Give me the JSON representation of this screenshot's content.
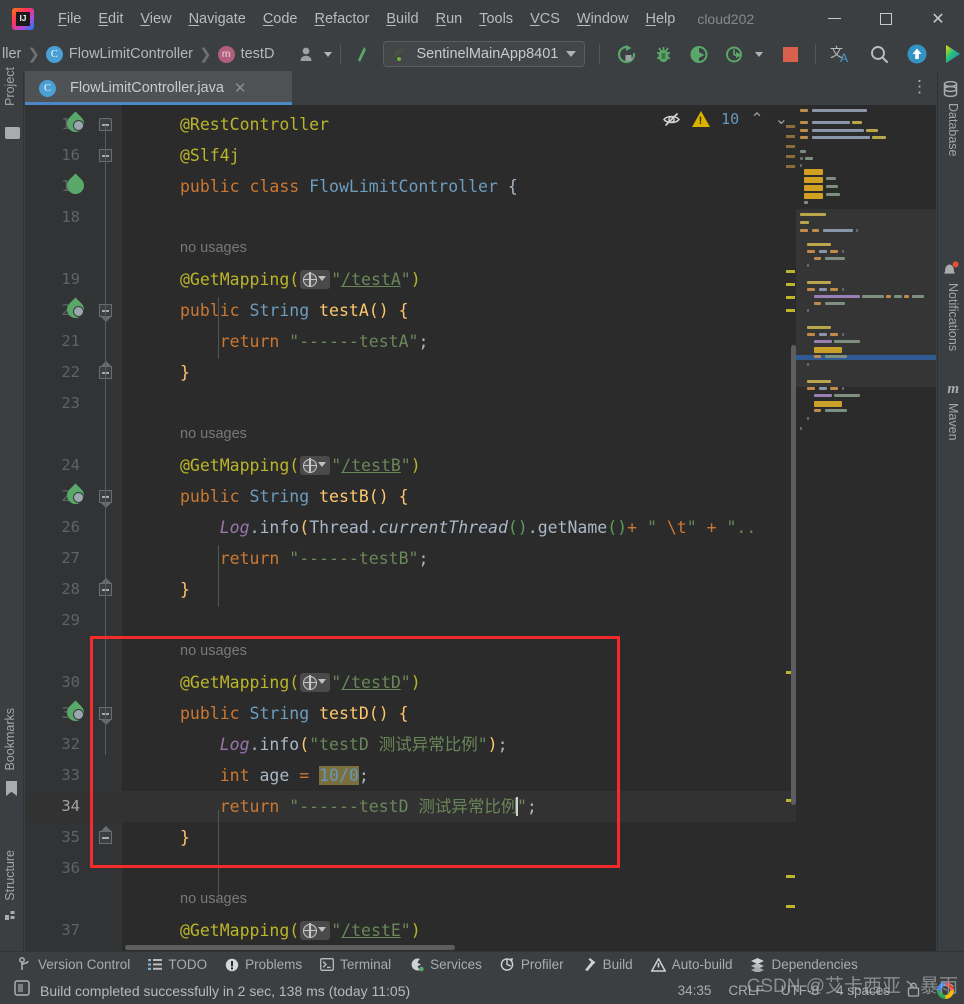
{
  "titlebar": {
    "logo_icon": "intellij-logo-icon",
    "menus": [
      "File",
      "Edit",
      "View",
      "Navigate",
      "Code",
      "Refactor",
      "Build",
      "Run",
      "Tools",
      "VCS",
      "Window",
      "Help"
    ],
    "project_title": "cloud202",
    "minimize": "–",
    "maximize": "▢",
    "close": "✕"
  },
  "toolbar": {
    "breadcrumb": [
      {
        "label": "ller",
        "icon": "none"
      },
      {
        "label": "FlowLimitController",
        "icon": "class-icon",
        "glyph": "C"
      },
      {
        "label": "testD",
        "icon": "method-icon",
        "glyph": "m"
      }
    ],
    "user_icon": "user-avatar-icon",
    "updates_icon": "update-arrow-icon",
    "run_config": "SentinelMainApp8401",
    "run_config_icon": "spring-boot-icon",
    "buttons": [
      "rerun-icon",
      "debug-icon",
      "run-with-coverage-icon",
      "profiler-icon",
      "stop-icon",
      "translate-icon",
      "search-everywhere-icon",
      "update-project-icon",
      "ide-feature-icon"
    ]
  },
  "left_stripe": [
    {
      "label": "Project",
      "icon": "project-folder-icon"
    },
    {
      "label": "Bookmarks",
      "icon": "bookmark-icon"
    },
    {
      "label": "Structure",
      "icon": "structure-icon"
    }
  ],
  "right_stripe": [
    {
      "label": "Database",
      "icon": "database-icon"
    },
    {
      "label": "Notifications",
      "icon": "bell-icon"
    },
    {
      "label": "Maven",
      "icon": "maven-icon"
    }
  ],
  "editor_tab": {
    "filename": "FlowLimitController.java",
    "icon": "java-class-icon",
    "close": "✕",
    "kebab": "⋮"
  },
  "inspections": {
    "eye_icon": "eye-off-icon",
    "warning_icon": "warning-triangle-icon",
    "warning_count": "10",
    "prev": "⌃",
    "next": "⌄"
  },
  "code": {
    "lines": [
      {
        "num": "15",
        "marker": "run-leaf-check",
        "fold": "top",
        "text_html": "<span class=\"ann\">@RestController</span>"
      },
      {
        "num": "16",
        "marker": "",
        "fold": "plain",
        "text_html": "<span class=\"ann\">@Slf4j</span>"
      },
      {
        "num": "17",
        "marker": "run-leaf",
        "fold": "",
        "text_html": "<span class=\"k\">public</span> <span class=\"k\">class</span> <span class=\"typ\">FlowLimitController</span> <span class=\"pun\">{</span>"
      },
      {
        "num": "18",
        "marker": "",
        "fold": "",
        "text_html": ""
      },
      {
        "num": "",
        "marker": "",
        "usage": "no usages",
        "fold": "",
        "text_html": ""
      },
      {
        "num": "19",
        "marker": "",
        "fold": "",
        "text_html": "<span class=\"ann\">@GetMapping(</span><WEB><span class=\"str\">\"</span><span class=\"url\">/testA</span><span class=\"str\">\"</span><span class=\"ann\">)</span>"
      },
      {
        "num": "20",
        "marker": "run-leaf-web",
        "fold": "pt",
        "text_html": "<span class=\"k\">public</span> <span class=\"typ\">String</span> <span class=\"mth\">testA</span><span class=\"brk\">()</span> <span class=\"brk\">{</span>"
      },
      {
        "num": "21",
        "marker": "",
        "fold": "",
        "text_html": "    <span class=\"k\">return</span> <span class=\"str\">\"------testA\"</span><span class=\"pun\">;</span>"
      },
      {
        "num": "22",
        "marker": "",
        "fold": "bt",
        "text_html": "<span class=\"brk\">}</span>"
      },
      {
        "num": "23",
        "marker": "",
        "fold": "",
        "text_html": ""
      },
      {
        "num": "",
        "marker": "",
        "usage": "no usages",
        "fold": "",
        "text_html": ""
      },
      {
        "num": "24",
        "marker": "",
        "fold": "",
        "text_html": "<span class=\"ann\">@GetMapping(</span><WEB><span class=\"str\">\"</span><span class=\"url\">/testB</span><span class=\"str\">\"</span><span class=\"ann\">)</span>"
      },
      {
        "num": "25",
        "marker": "run-leaf-web",
        "fold": "pt",
        "text_html": "<span class=\"k\">public</span> <span class=\"typ\">String</span> <span class=\"mth\">testB</span><span class=\"brk\">()</span> <span class=\"brk\">{</span>"
      },
      {
        "num": "26",
        "marker": "",
        "fold": "",
        "text_html": "    <span class=\"fld\">Log</span><span class=\"pun\">.</span>info<span class=\"brk\">(</span><span class=\"cls\">Thread</span><span class=\"pun\">.</span><span class=\"itl\">currentThread</span><span class=\"par-g\">()</span><span class=\"pun\">.</span>getName<span class=\"par-g\">()</span><span class=\"k\">+</span> <span class=\"str\">\" </span><span class=\"esc\">\\t</span><span class=\"str\">\"</span> <span class=\"k\">+</span> <span class=\"str\">\"..</span>"
      },
      {
        "num": "27",
        "marker": "",
        "fold": "",
        "text_html": "    <span class=\"k\">return</span> <span class=\"str\">\"------testB\"</span><span class=\"pun\">;</span>"
      },
      {
        "num": "28",
        "marker": "",
        "fold": "bt",
        "text_html": "<span class=\"brk\">}</span>"
      },
      {
        "num": "29",
        "marker": "",
        "fold": "",
        "text_html": ""
      },
      {
        "num": "",
        "marker": "",
        "usage": "no usages",
        "fold": "",
        "text_html": ""
      },
      {
        "num": "30",
        "marker": "",
        "fold": "",
        "text_html": "<span class=\"ann\">@GetMapping(</span><WEB><span class=\"str\">\"</span><span class=\"url\">/testD</span><span class=\"str\">\"</span><span class=\"ann\">)</span>"
      },
      {
        "num": "31",
        "marker": "run-leaf-web",
        "fold": "pt",
        "text_html": "<span class=\"k\">public</span> <span class=\"typ\">String</span> <span class=\"mth\">testD</span><span class=\"brk\">()</span> <span class=\"brk\">{</span>"
      },
      {
        "num": "32",
        "marker": "",
        "fold": "",
        "text_html": "    <span class=\"fld\">Log</span><span class=\"pun\">.</span>info<span class=\"brk\">(</span><span class=\"str\">\"testD 测试异常比例\"</span><span class=\"brk\">)</span><span class=\"pun\">;</span>"
      },
      {
        "num": "33",
        "marker": "",
        "fold": "",
        "text_html": "    <span class=\"k\">int</span> age <span class=\"k\">=</span> <span class=\"numhl\">10/0</span><span class=\"pun\">;</span>"
      },
      {
        "num": "34",
        "marker": "",
        "current": true,
        "fold": "",
        "text_html": "    <span class=\"k\">return</span> <span class=\"str\">\"------testD 测试异常比例</span><CARET><span class=\"str\">\"</span><span class=\"pun\">;</span>"
      },
      {
        "num": "35",
        "marker": "",
        "fold": "bt",
        "text_html": "<span class=\"brk\">}</span>"
      },
      {
        "num": "36",
        "marker": "",
        "fold": "",
        "text_html": ""
      },
      {
        "num": "",
        "marker": "",
        "usage": "no usages",
        "fold": "",
        "text_html": ""
      },
      {
        "num": "37",
        "marker": "",
        "fold": "",
        "text_html": "<span class=\"ann\">@GetMapping(</span><WEB><span class=\"str\">\"</span><span class=\"url\">/testE</span><span class=\"str\">\"</span><span class=\"ann\">)</span>"
      }
    ],
    "annotation_box_color": "#f52a2a"
  },
  "tool_windows": [
    {
      "label": "Version Control",
      "icon": "branch-icon"
    },
    {
      "label": "TODO",
      "icon": "todo-list-icon"
    },
    {
      "label": "Problems",
      "icon": "problems-icon"
    },
    {
      "label": "Terminal",
      "icon": "terminal-icon"
    },
    {
      "label": "Services",
      "icon": "services-icon"
    },
    {
      "label": "Profiler",
      "icon": "profiler-icon"
    },
    {
      "label": "Build",
      "icon": "build-hammer-icon"
    },
    {
      "label": "Auto-build",
      "icon": "auto-build-icon"
    },
    {
      "label": "Dependencies",
      "icon": "dependencies-icon"
    }
  ],
  "statusbar": {
    "build_icon": "build-status-icon",
    "message": "Build completed successfully in 2 sec, 138 ms (today 11:05)",
    "caret_position": "34:35",
    "line_separator": "CRLF",
    "encoding": "UTF-8",
    "indent": "4 spaces",
    "lock_icon": "read-only-lock-icon"
  },
  "watermark": "CSDN @艾卡西亚丶暴雨",
  "colors": {
    "accent": "#4a88c7",
    "annotation_red": "#f52a2a",
    "keyword": "#cc7832",
    "string": "#6a8759",
    "annotation": "#bbb529",
    "method": "#ffc66d",
    "number": "#6897bb",
    "editor_bg": "#2b2b2b",
    "chrome_bg": "#3c3f41"
  }
}
